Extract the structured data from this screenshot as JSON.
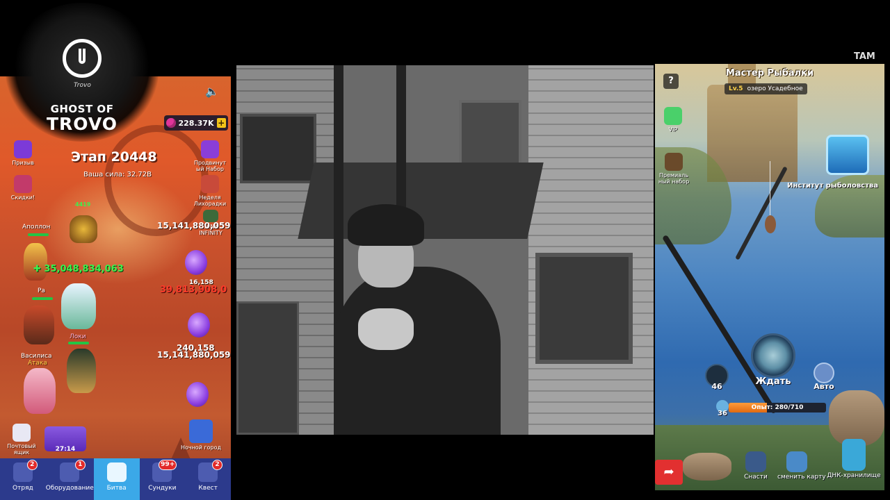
{
  "left_game": {
    "gems": "228.37K",
    "stage_title": "Этап 20448",
    "power": "Ваша сила: 32.72B",
    "side_left": [
      {
        "label": "Призыв"
      },
      {
        "label": "Скидки!"
      }
    ],
    "side_right": [
      {
        "label": "Продвинут ый Набор"
      },
      {
        "label": "Неделя Лихорадки"
      },
      {
        "label": "TANK INFINITY"
      }
    ],
    "heroes": [
      {
        "name": "Аполлон"
      },
      {
        "name": "Ра"
      },
      {
        "name": "Локи"
      },
      {
        "name": "Василиса"
      }
    ],
    "attack_label": "Атака",
    "hero_level": "4419",
    "damage": {
      "heal": "35,048,834,063",
      "enemy_hp_top": "15,141,880,059",
      "crit": "39,813,908,0",
      "enemy_hp_mid": "240,158",
      "enemy_hp_bottom": "15,141,880,059",
      "small": "16,158"
    },
    "mailbox_label": "Почтовый ящик",
    "timer": "27:14",
    "night_city_label": "Ночной город",
    "nav": [
      {
        "label": "Отряд",
        "badge": "2",
        "active": false
      },
      {
        "label": "Оборудование",
        "badge": "1",
        "active": false
      },
      {
        "label": "Битва",
        "badge": "",
        "active": true
      },
      {
        "label": "Сундуки",
        "badge": "99+",
        "active": false
      },
      {
        "label": "Квест",
        "badge": "2",
        "active": false
      }
    ]
  },
  "logo": {
    "tag": "Trovo",
    "line1": "GHOST OF",
    "line2": "TROVO"
  },
  "right_game": {
    "title": "Мастер Рыбалки",
    "level": "Lv.5",
    "location": "озеро Усадебное",
    "help": "?",
    "side": [
      {
        "label": "VIP"
      },
      {
        "label": "Премиаль ный набор"
      }
    ],
    "institute_label": "Институт рыболовства",
    "bait_count": "46",
    "wait_label": "Ждать",
    "auto_label": "Авто",
    "xp_level": "36",
    "xp_text": "Опыт: 280/710",
    "xp_progress": 0.394,
    "bottom": [
      {
        "label": "Снасти"
      },
      {
        "label": "сменить карту"
      },
      {
        "label": "ДНК-хранилище"
      }
    ]
  },
  "corner_tag": "TAM"
}
